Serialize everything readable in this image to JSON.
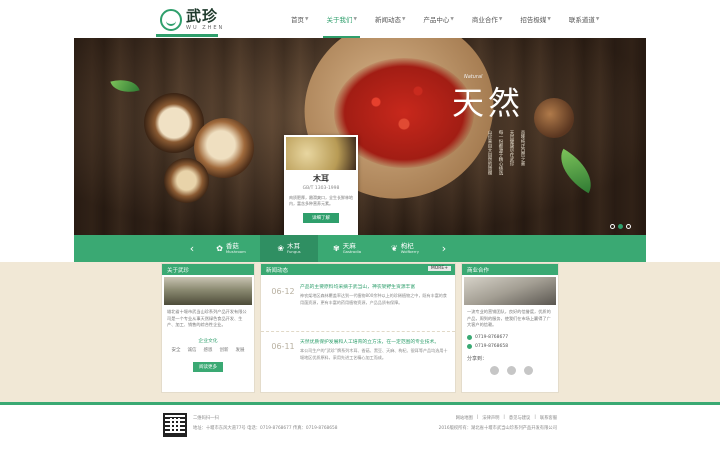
{
  "brand": {
    "name_cn": "武珍",
    "name_en": "WU ZHEN"
  },
  "nav": [
    {
      "label": "首页",
      "active": false
    },
    {
      "label": "关于我们",
      "active": true
    },
    {
      "label": "新闻动态",
      "active": false
    },
    {
      "label": "产品中心",
      "active": false
    },
    {
      "label": "商业合作",
      "active": false
    },
    {
      "label": "招告极媒",
      "active": false
    },
    {
      "label": "联系道道",
      "active": false
    }
  ],
  "banner": {
    "title": "天然",
    "en": "Natural",
    "poem": [
      "山珍来自大自然的馈赠",
      "每一份都源于精心挑选",
      "天然健康尽在武珍",
      "品味纯正自然之美"
    ],
    "card": {
      "name": "木耳",
      "standard": "GB/T 1303-1998",
      "desc": "肉质肥厚，嫩滑爽口，全生长鲜林地内，富含多种营养元素。",
      "button": "详细了解"
    }
  },
  "categories": [
    {
      "cn": "香菇",
      "en": "Mushroom",
      "icon": "mushroom-icon",
      "active": false
    },
    {
      "cn": "木耳",
      "en": "Fungus",
      "icon": "fungus-icon",
      "active": true
    },
    {
      "cn": "天麻",
      "en": "Gastrodia",
      "icon": "gastrodia-icon",
      "active": false
    },
    {
      "cn": "枸杞",
      "en": "Wolfberry",
      "icon": "wolfberry-icon",
      "active": false
    }
  ],
  "about": {
    "title": "关于武珍",
    "text": "雄北省十堰市武当山珍系列产品开发有限公司是一个专业从事天然绿色食品开发、生产、加工、销售的综合性企业。",
    "culture_title": "企业文化",
    "values": [
      "安全",
      "诚信",
      "感恩",
      "创新",
      "发展"
    ],
    "button": "阅读更多"
  },
  "news": {
    "title": "新闻动态",
    "more": "MORE+",
    "items": [
      {
        "date": "06-12",
        "title": "产品的主要原料均采摘于武当山，神农架野生资源丰富",
        "text": "神农架地区森林覆盖率达到一代植物800余种以上的珍稀植物之中，既有丰富的食用菌资源，更有丰富的药用植物资源，产品品质有保障。"
      },
      {
        "date": "06-11",
        "title": "天然优质保护发展和人工培育的立方法，在一定范围的专业技术。",
        "text": "本公司生产的“武珍”牌系列木耳、香菇、黑豆、天麻、枸杞、银耳等产品均选用十堰地区优质原料，采用先进工艺精心加工而成。"
      }
    ]
  },
  "cooperation": {
    "title": "商业合作",
    "text": "一流专业的营销团队，良好的信誉度，优质的产品，周到的服务，使我们在市场上赢得了广大客户的信赖。",
    "phones": [
      "0719-8768677",
      "0719-8768658"
    ],
    "share_label": "分享到："
  },
  "footer": {
    "scan": "二维码扫一扫",
    "contact": "地址：十堰市东风大道77号    电话：0719-8768677    传真：0719-8768658",
    "links": [
      "网站地图",
      "法律声明",
      "意见与建议",
      "联系客服"
    ],
    "copyright": "2016版权所有：湖北省十堰市武当山珍系列产品开发有限公司"
  },
  "colors": {
    "brand_green": "#3aa973",
    "accent_green": "#2f9f6c",
    "content_bg": "#f1e8d6"
  }
}
